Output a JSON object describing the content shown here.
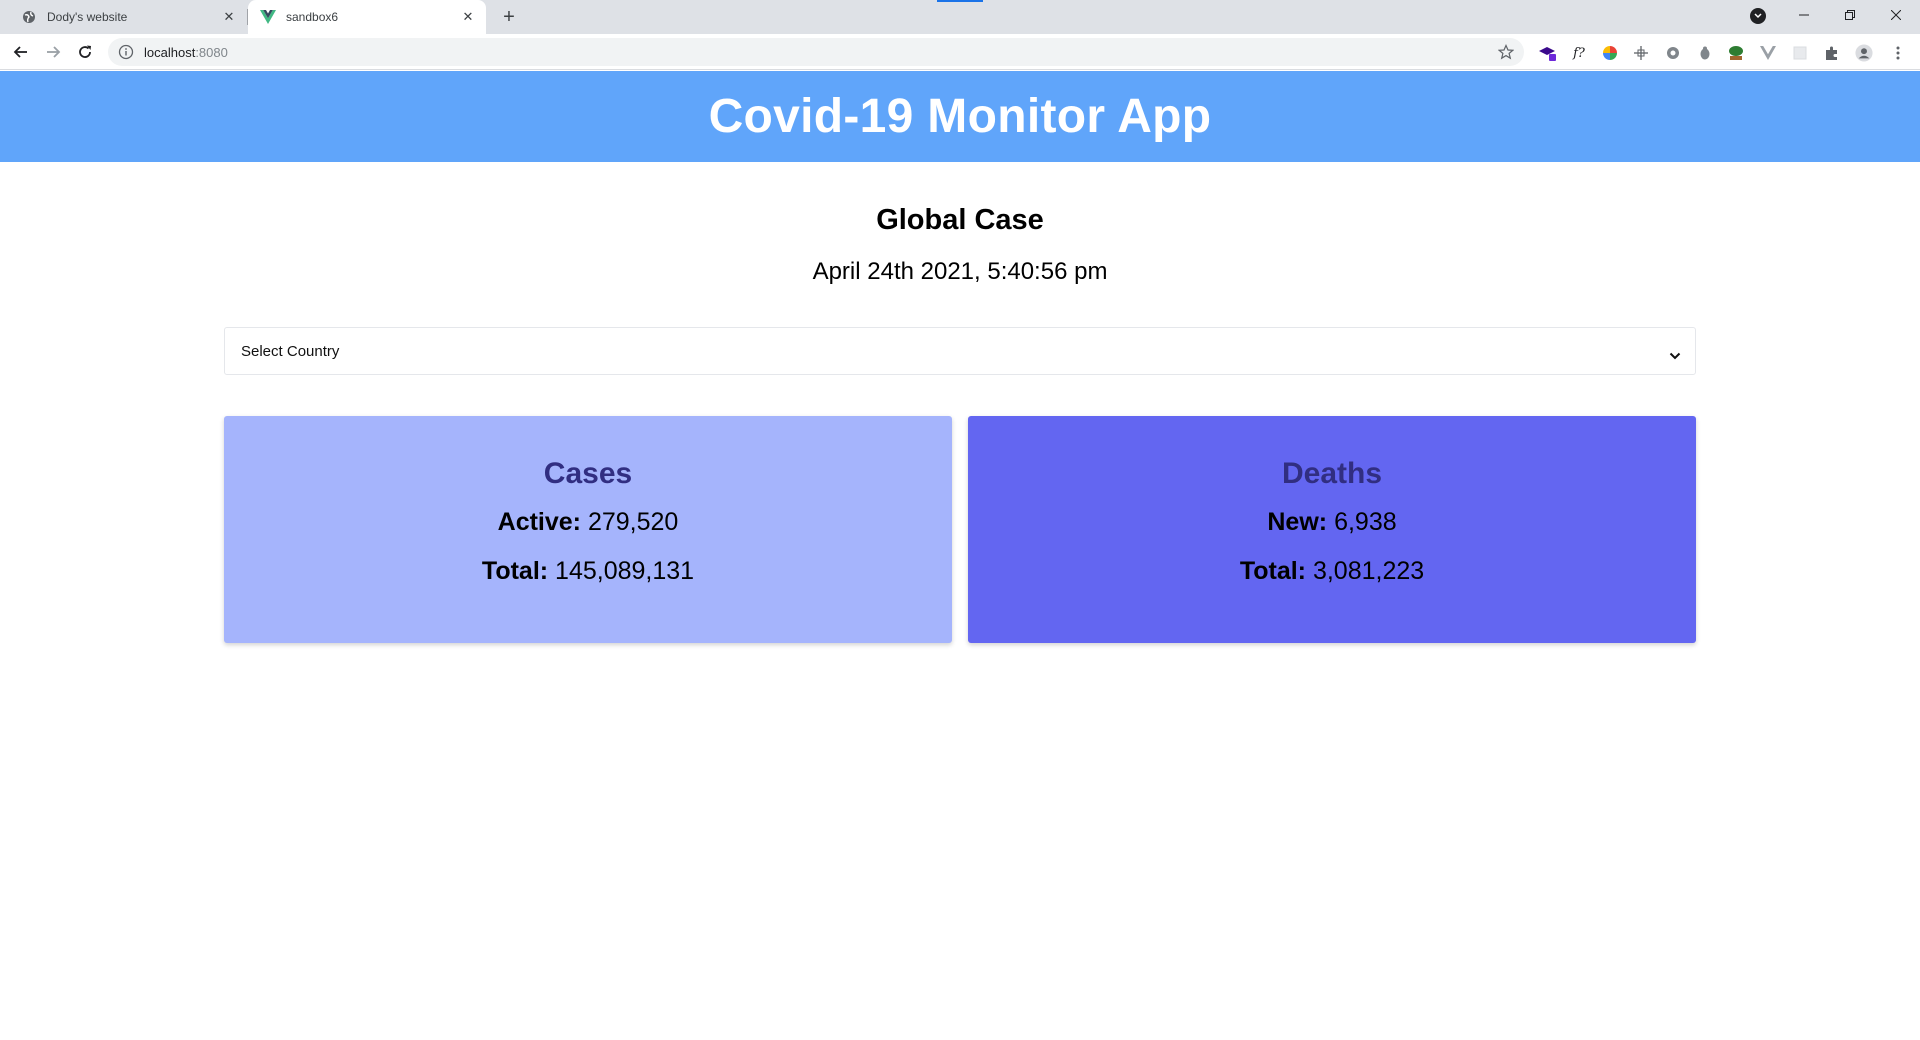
{
  "browser": {
    "tabs": [
      {
        "title": "Dody's website",
        "active": false
      },
      {
        "title": "sandbox6",
        "active": true
      }
    ],
    "url_host": "localhost",
    "url_port": ":8080"
  },
  "app": {
    "title": "Covid-19 Monitor App"
  },
  "main": {
    "heading": "Global Case",
    "date": "April 24th 2021, 5:40:56 pm",
    "country_select": {
      "selected": "Select Country"
    },
    "cards": {
      "cases": {
        "title": "Cases",
        "row1_label": "Active:",
        "row1_value": "279,520",
        "row2_label": "Total:",
        "row2_value": "145,089,131"
      },
      "deaths": {
        "title": "Deaths",
        "row1_label": "New:",
        "row1_value": "6,938",
        "row2_label": "Total:",
        "row2_value": "3,081,223"
      }
    }
  },
  "colors": {
    "header_bg": "#60a5fa",
    "cases_bg": "#a5b4fc",
    "deaths_bg": "#6366f1",
    "card_title": "#312e81"
  }
}
